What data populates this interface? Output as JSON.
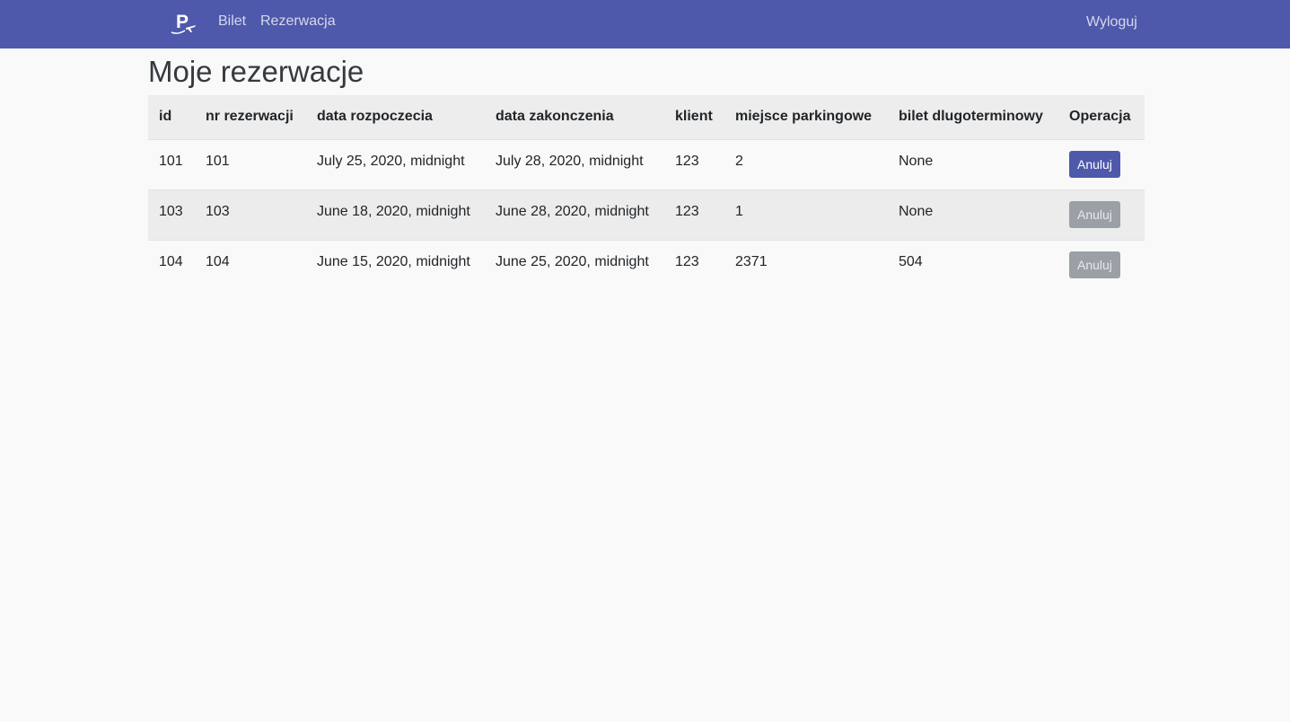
{
  "navbar": {
    "brand_icon": "parking-plane-logo-icon",
    "links": [
      {
        "label": "Bilet"
      },
      {
        "label": "Rezerwacja"
      }
    ],
    "logout_label": "Wyloguj",
    "bg_color": "#4e59ab"
  },
  "page": {
    "title": "Moje rezerwacje"
  },
  "table": {
    "headers": [
      "id",
      "nr rezerwacji",
      "data rozpoczecia",
      "data zakonczenia",
      "klient",
      "miejsce parkingowe",
      "bilet dlugoterminowy",
      "Operacja"
    ],
    "rows": [
      {
        "id": "101",
        "nr": "101",
        "start": "July 25, 2020, midnight",
        "end": "July 28, 2020, midnight",
        "client": "123",
        "spot": "2",
        "ticket": "None",
        "action_label": "Anuluj",
        "action_enabled": true
      },
      {
        "id": "103",
        "nr": "103",
        "start": "June 18, 2020, midnight",
        "end": "June 28, 2020, midnight",
        "client": "123",
        "spot": "1",
        "ticket": "None",
        "action_label": "Anuluj",
        "action_enabled": false
      },
      {
        "id": "104",
        "nr": "104",
        "start": "June 15, 2020, midnight",
        "end": "June 25, 2020, midnight",
        "client": "123",
        "spot": "2371",
        "ticket": "504",
        "action_label": "Anuluj",
        "action_enabled": false
      }
    ]
  }
}
